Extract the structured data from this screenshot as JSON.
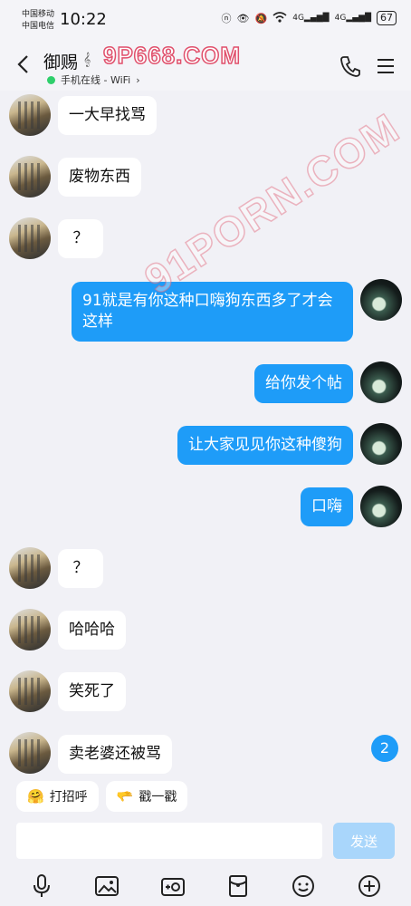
{
  "status_bar": {
    "carrier1": "中国移动",
    "carrier2": "中国电信",
    "time": "10:22",
    "signal1": "4G",
    "signal2": "4G",
    "battery": "67"
  },
  "header": {
    "title": "御赐",
    "presence": "手机在线 - WiFi",
    "watermark": "9P668.COM"
  },
  "overlay_watermark": "91PORN.COM",
  "messages": [
    {
      "side": "in",
      "text": "一大早找骂"
    },
    {
      "side": "in",
      "text": "废物东西"
    },
    {
      "side": "in",
      "text": "？"
    },
    {
      "side": "out",
      "text": "91就是有你这种口嗨狗东西多了才会这样"
    },
    {
      "side": "out",
      "text": "给你发个帖"
    },
    {
      "side": "out",
      "text": "让大家见见你这种傻狗"
    },
    {
      "side": "out",
      "text": "口嗨"
    },
    {
      "side": "in",
      "text": "？"
    },
    {
      "side": "in",
      "text": "哈哈哈"
    },
    {
      "side": "in",
      "text": "笑死了"
    },
    {
      "side": "in",
      "text": "卖老婆还被骂"
    }
  ],
  "unread_count": "2",
  "quick_replies": [
    {
      "label": "打招呼",
      "icon": "wave-emoji-icon"
    },
    {
      "label": "戳一戳",
      "icon": "poke-emoji-icon"
    }
  ],
  "composer": {
    "value": "",
    "send_label": "发送"
  },
  "toolbar_icons": [
    "microphone-icon",
    "image-icon",
    "camera-icon",
    "red-packet-icon",
    "emoji-icon",
    "plus-icon"
  ],
  "colors": {
    "accent": "#1e9cf8",
    "background": "#f1f1f6",
    "online": "#2fcf6c"
  }
}
